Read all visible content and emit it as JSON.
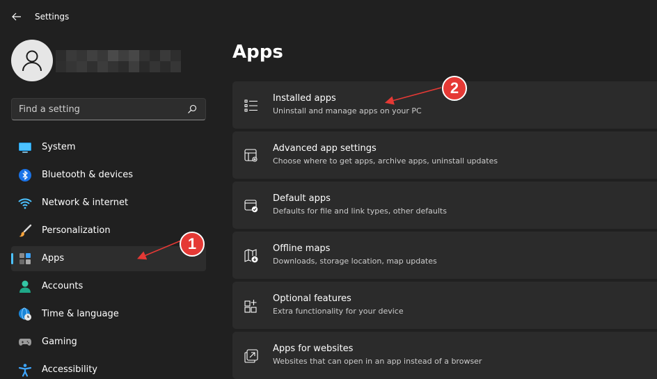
{
  "window": {
    "title": "Settings"
  },
  "sidebar": {
    "search_placeholder": "Find a setting",
    "items": [
      {
        "label": "System",
        "icon": "monitor-icon"
      },
      {
        "label": "Bluetooth & devices",
        "icon": "bluetooth-icon"
      },
      {
        "label": "Network & internet",
        "icon": "wifi-icon"
      },
      {
        "label": "Personalization",
        "icon": "paintbrush-icon"
      },
      {
        "label": "Apps",
        "icon": "apps-icon",
        "selected": true
      },
      {
        "label": "Accounts",
        "icon": "person-icon"
      },
      {
        "label": "Time & language",
        "icon": "globe-clock-icon"
      },
      {
        "label": "Gaming",
        "icon": "gamepad-icon"
      },
      {
        "label": "Accessibility",
        "icon": "accessibility-icon"
      }
    ]
  },
  "main": {
    "title": "Apps",
    "cards": [
      {
        "title": "Installed apps",
        "subtitle": "Uninstall and manage apps on your PC",
        "icon": "list-icon"
      },
      {
        "title": "Advanced app settings",
        "subtitle": "Choose where to get apps, archive apps, uninstall updates",
        "icon": "app-settings-icon"
      },
      {
        "title": "Default apps",
        "subtitle": "Defaults for file and link types, other defaults",
        "icon": "default-apps-icon"
      },
      {
        "title": "Offline maps",
        "subtitle": "Downloads, storage location, map updates",
        "icon": "map-download-icon"
      },
      {
        "title": "Optional features",
        "subtitle": "Extra functionality for your device",
        "icon": "add-grid-icon"
      },
      {
        "title": "Apps for websites",
        "subtitle": "Websites that can open in an app instead of a browser",
        "icon": "open-link-icon"
      }
    ]
  },
  "annotations": {
    "badge_1": "1",
    "badge_2": "2"
  },
  "colors": {
    "background": "#202020",
    "card": "#2b2b2b",
    "accent": "#4cc2ff",
    "annotation": "#e53935"
  }
}
